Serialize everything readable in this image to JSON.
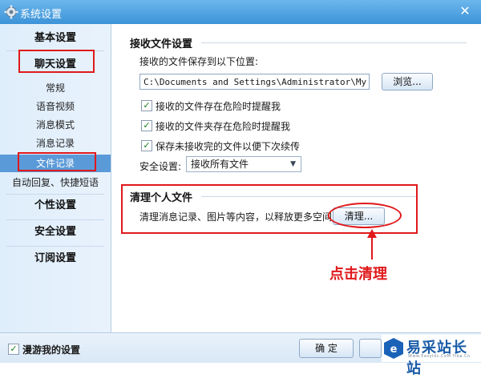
{
  "window": {
    "title": "系统设置",
    "close_glyph": "✕"
  },
  "sidebar": {
    "categories": [
      {
        "label": "基本设置"
      },
      {
        "label": "聊天设置"
      },
      {
        "label": "个性设置"
      },
      {
        "label": "安全设置"
      },
      {
        "label": "订阅设置"
      }
    ],
    "chat_items": [
      {
        "label": "常规"
      },
      {
        "label": "语音视频"
      },
      {
        "label": "消息模式"
      },
      {
        "label": "消息记录"
      },
      {
        "label": "文件记录"
      },
      {
        "label": "自动回复、快捷短语"
      }
    ],
    "selected": "文件记录"
  },
  "receive": {
    "title": "接收文件设置",
    "save_location_label": "接收的文件保存到以下位置:",
    "path_value": "C:\\Documents and Settings\\Administrator\\My Docum",
    "browse_label": "浏览...",
    "options": [
      {
        "label": "接收的文件存在危险时提醒我",
        "checked": true
      },
      {
        "label": "接收的文件夹存在危险时提醒我",
        "checked": true
      },
      {
        "label": "保存未接收完的文件以便下次续传",
        "checked": true
      }
    ],
    "security_label": "安全设置:",
    "security_value": "接收所有文件"
  },
  "cleanup": {
    "title": "清理个人文件",
    "description": "清理消息记录、图片等内容，以释放更多空间",
    "clean_label": "清理..."
  },
  "annotation": {
    "text": "点击清理",
    "color": "#e0191b"
  },
  "footer": {
    "roaming_label": "漫游我的设置",
    "roaming_checked": true,
    "ok_label": "确 定"
  },
  "watermark": {
    "text": "易采站长站",
    "sub": "Www.EasyIdc.CoM  Yiba.Cn"
  },
  "colors": {
    "titlebar": "#3c93d8",
    "selected": "#5b9ad8",
    "annotation": "#e0191b"
  }
}
